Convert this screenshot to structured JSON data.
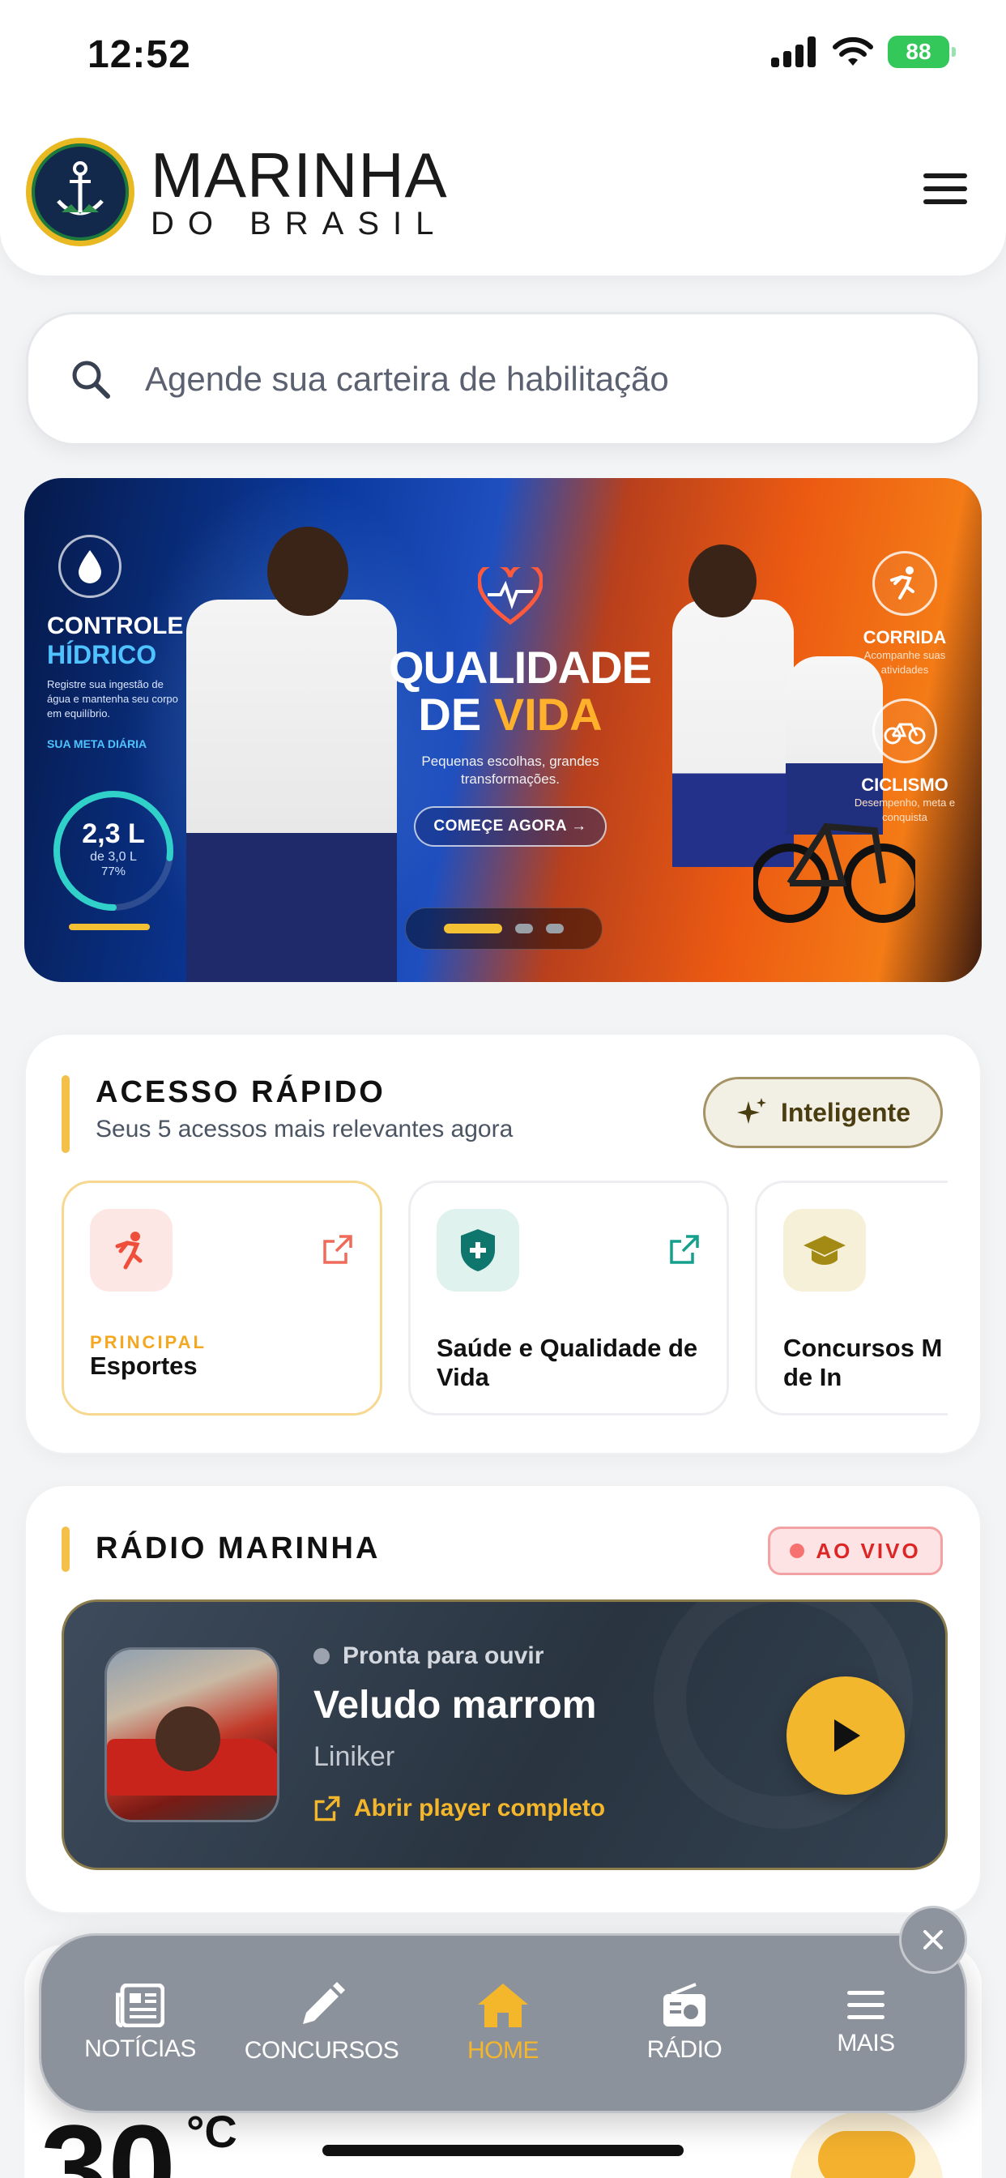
{
  "status_bar": {
    "time": "12:52",
    "battery": "88"
  },
  "header": {
    "brand_line1": "MARINHA",
    "brand_line2": "DO BRASIL",
    "menu_icon": "hamburger-icon"
  },
  "search": {
    "placeholder": "Agende sua carteira de habilitação",
    "icon": "search-icon"
  },
  "banner": {
    "left_title1": "CONTROLE",
    "left_title2": "HÍDRICO",
    "left_desc": "Registre sua ingestão de água e mantenha seu corpo em equilíbrio.",
    "left_goal_label": "SUA META DIÁRIA",
    "gauge_value": "2,3 L",
    "gauge_of": "de 3,0 L",
    "gauge_percent": "77%",
    "gauge_fraction": 0.77,
    "center_title1": "QUALIDADE",
    "center_title2a": "DE ",
    "center_title2b": "VIDA",
    "center_sub": "Pequenas escolhas, grandes transformações.",
    "cta_label": "COMEÇE AGORA →",
    "right_item1_title": "CORRIDA",
    "right_item1_sub": "Acompanhe suas atividades",
    "right_item2_title": "CICLISMO",
    "right_item2_sub": "Desempenho, meta e conquista",
    "active_slide": 1,
    "slide_count": 3
  },
  "quick_access": {
    "title": "ACESSO RÁPIDO",
    "subtitle": "Seus 5 acessos mais relevantes agora",
    "smart_button": "Inteligente",
    "tiles": [
      {
        "tag": "PRINCIPAL",
        "label": "Esportes",
        "icon": "running-icon"
      },
      {
        "tag": "",
        "label": "Saúde e Qualidade de Vida",
        "icon": "shield-plus-icon"
      },
      {
        "tag": "",
        "label": "Concursos M (Formas de In",
        "icon": "graduation-cap-icon"
      }
    ]
  },
  "radio": {
    "title": "RÁDIO MARINHA",
    "live_label": "AO VIVO",
    "status": "Pronta para ouvir",
    "track": "Veludo marrom",
    "artist": "Liniker",
    "open_player": "Abrir player completo"
  },
  "weather": {
    "temp": "30",
    "unit": "°C"
  },
  "bottom_nav": {
    "items": [
      {
        "label": "NOTÍCIAS",
        "icon": "newspaper-icon"
      },
      {
        "label": "CONCURSOS",
        "icon": "pencil-icon"
      },
      {
        "label": "HOME",
        "icon": "home-icon"
      },
      {
        "label": "RÁDIO",
        "icon": "radio-icon"
      },
      {
        "label": "MAIS",
        "icon": "menu-lines-icon"
      }
    ],
    "active": "HOME"
  },
  "colors": {
    "accent": "#f4b62b",
    "live": "#dc2626",
    "primary_tag": "#f4a822",
    "teal": "#0f766e"
  }
}
